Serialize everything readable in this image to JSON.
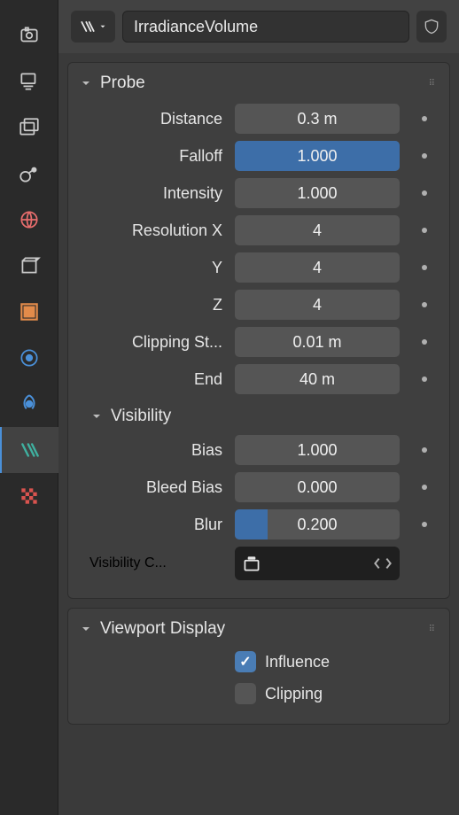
{
  "header": {
    "name": "IrradianceVolume"
  },
  "probe": {
    "title": "Probe",
    "distance_label": "Distance",
    "distance": "0.3 m",
    "falloff_label": "Falloff",
    "falloff": "1.000",
    "intensity_label": "Intensity",
    "intensity": "1.000",
    "resx_label": "Resolution X",
    "resx": "4",
    "resy_label": "Y",
    "resy": "4",
    "resz_label": "Z",
    "resz": "4",
    "clip_start_label": "Clipping St...",
    "clip_start": "0.01 m",
    "clip_end_label": "End",
    "clip_end": "40 m"
  },
  "visibility": {
    "title": "Visibility",
    "bias_label": "Bias",
    "bias": "1.000",
    "bleed_label": "Bleed Bias",
    "bleed": "0.000",
    "blur_label": "Blur",
    "blur": "0.200",
    "collection_label": "Visibility C..."
  },
  "viewport": {
    "title": "Viewport Display",
    "influence_label": "Influence",
    "clipping_label": "Clipping"
  }
}
